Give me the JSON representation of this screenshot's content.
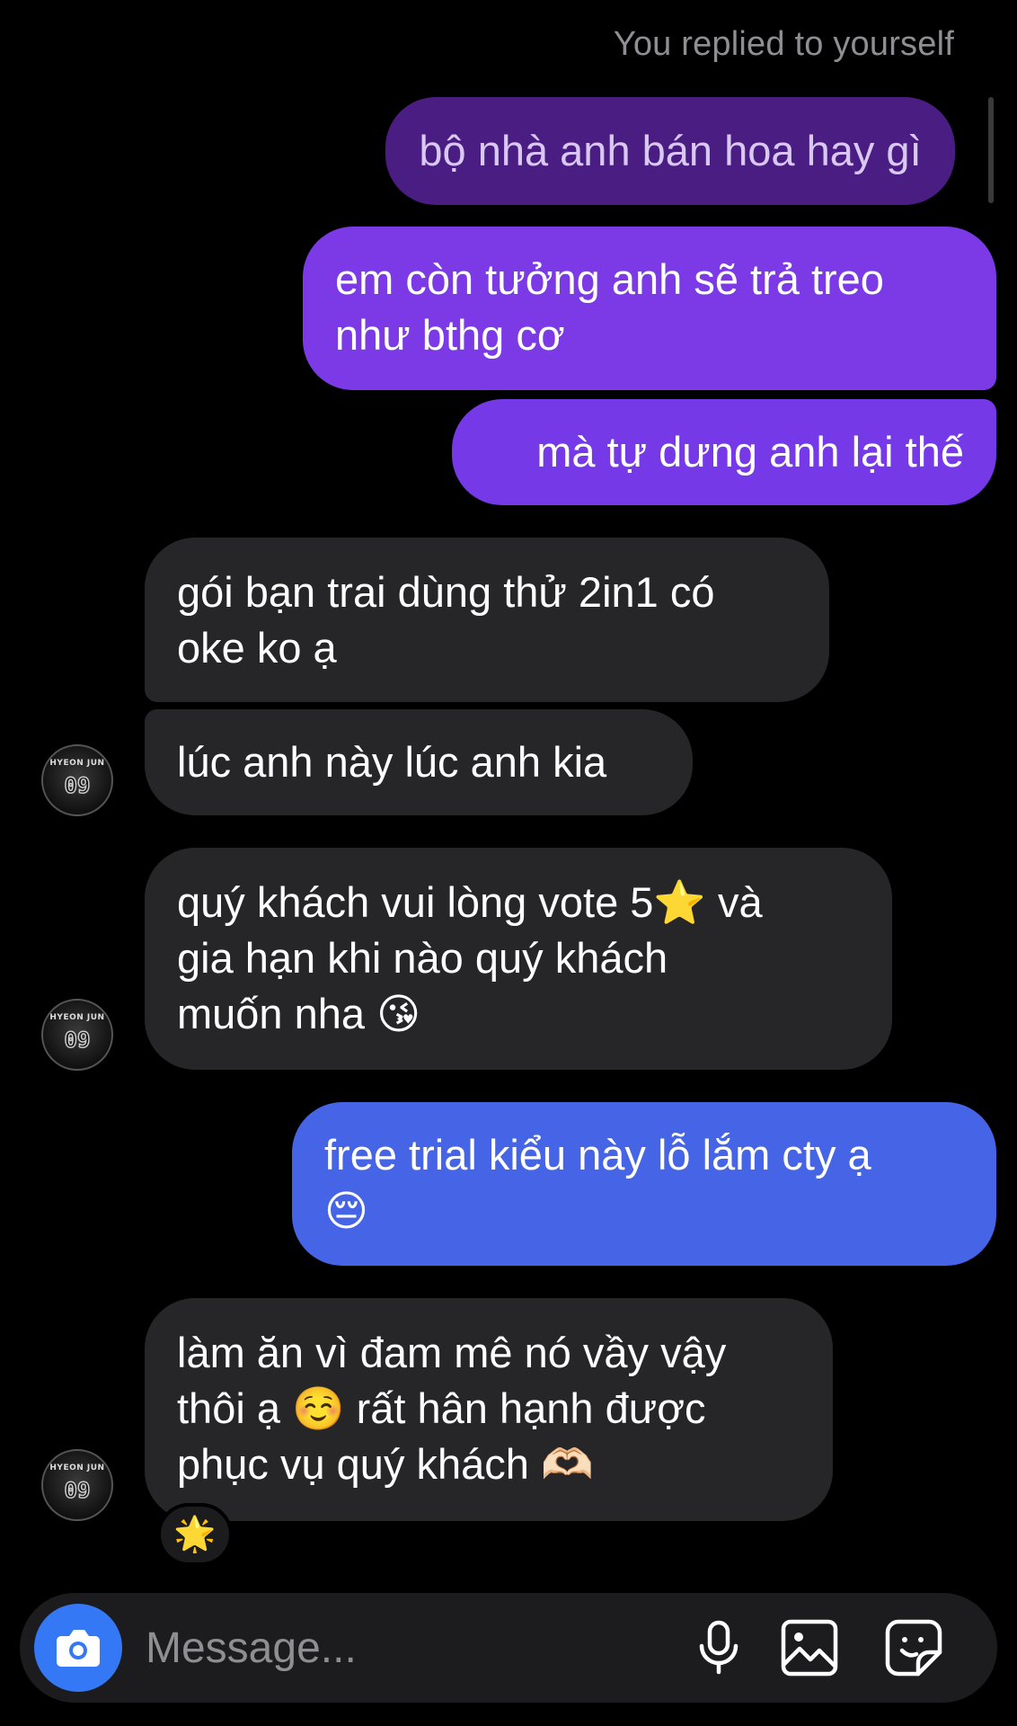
{
  "header": {
    "reply_note": "You replied to yourself"
  },
  "messages": [
    {
      "id": "m1",
      "direction": "outgoing",
      "lines": [
        "bộ nhà anh bán hoa hay gì"
      ]
    },
    {
      "id": "m2",
      "direction": "outgoing",
      "lines": [
        "em còn tưởng anh sẽ trả treo",
        "như bthg cơ"
      ]
    },
    {
      "id": "m3",
      "direction": "outgoing",
      "lines": [
        "mà tự dưng anh lại thế"
      ]
    },
    {
      "id": "m4",
      "direction": "incoming",
      "lines": [
        "gói bạn trai dùng thử 2in1 có",
        "oke ko ạ"
      ]
    },
    {
      "id": "m5",
      "direction": "incoming",
      "lines": [
        "lúc anh này lúc anh kia"
      ]
    },
    {
      "id": "m6",
      "direction": "incoming",
      "lines": [
        "quý khách vui lòng vote 5⭐ và",
        "gia hạn khi nào quý khách",
        "muốn nha 😘"
      ]
    },
    {
      "id": "m7",
      "direction": "outgoing",
      "lines": [
        "free trial kiểu này lỗ lắm cty ạ",
        "😔"
      ]
    },
    {
      "id": "m8",
      "direction": "incoming",
      "lines": [
        "làm ăn vì đam mê nó vầy vậy",
        "thôi ạ ☺️ rất hân hạnh được",
        "phục vụ quý khách 🫶🏻"
      ]
    }
  ],
  "reaction": {
    "emoji": "🌟"
  },
  "avatar": {
    "jersey_name": "HYEON JUN",
    "jersey_number": "09"
  },
  "composer": {
    "placeholder": "Message...",
    "icons": [
      "camera-icon",
      "microphone-icon",
      "gallery-icon",
      "sticker-icon"
    ]
  },
  "colors": {
    "outgoing_dark": "#4a1d82",
    "outgoing_purple": "#7b3ae6",
    "outgoing_blue": "#4565e6",
    "incoming": "#262628",
    "camera_button": "#3478f6"
  }
}
